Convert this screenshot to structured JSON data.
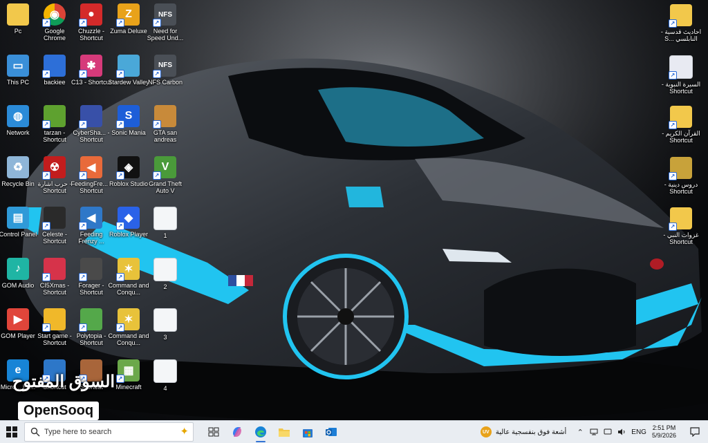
{
  "watermark": {
    "arabic": "السوق المفتوح",
    "english": "OpenSooq"
  },
  "desktop": {
    "col1": [
      {
        "name": "pc-icon",
        "label": "Pc",
        "icon": "user-folder-icon"
      },
      {
        "name": "this-pc-icon",
        "label": "This PC",
        "icon": "monitor-icon"
      },
      {
        "name": "network-icon",
        "label": "Network",
        "icon": "network-globe-icon"
      },
      {
        "name": "recycle-bin-icon",
        "label": "Recycle Bin",
        "icon": "recycle-bin-icon"
      },
      {
        "name": "control-panel-icon",
        "label": "Control Panel",
        "icon": "control-panel-icon"
      },
      {
        "name": "gom-audio-icon",
        "label": "GOM Audio",
        "icon": "gom-audio-icon"
      },
      {
        "name": "gom-player-icon",
        "label": "GOM Player",
        "icon": "gom-player-icon"
      },
      {
        "name": "microsoft-edge-icon",
        "label": "Micro... Ed...",
        "icon": "edge-icon"
      }
    ],
    "col2": [
      {
        "name": "google-chrome-icon",
        "label": "Google Chrome",
        "icon": "chrome-icon"
      },
      {
        "name": "backiee-icon",
        "label": "backiee",
        "icon": "backiee-icon"
      },
      {
        "name": "tarzan-icon",
        "label": "tarzan - Shortcut",
        "icon": "tarzan-icon"
      },
      {
        "name": "war-game-icon",
        "label": "حرب اشارة - Shortcut",
        "icon": "radiation-icon"
      },
      {
        "name": "celeste-icon",
        "label": "Celeste - Shortcut",
        "icon": "strawberry-icon"
      },
      {
        "name": "ci5xmas-icon",
        "label": "CI5Xmas - Shortcut",
        "icon": "xmas-game-icon"
      },
      {
        "name": "start-game-icon",
        "label": "Start game - Shortcut",
        "icon": "start-game-icon"
      },
      {
        "name": "shortcut-bottom-icon",
        "label": "Shortcut",
        "icon": "game-icon"
      }
    ],
    "col3": [
      {
        "name": "chuzzle-icon",
        "label": "Chuzzle - Shortcut",
        "icon": "chuzzle-icon"
      },
      {
        "name": "c13-icon",
        "label": "C13 - Shortcut",
        "icon": "c13-icon"
      },
      {
        "name": "cybershark-icon",
        "label": "CyberSha... - Shortcut",
        "icon": "cybershark-icon"
      },
      {
        "name": "feeding-frenzy-1-icon",
        "label": "FeedingFre... - Shortcut",
        "icon": "fish-icon"
      },
      {
        "name": "feeding-frenzy-2-icon",
        "label": "Feeding Frenzy ...",
        "icon": "fish2-icon"
      },
      {
        "name": "forager-icon",
        "label": "Forager - Shortcut",
        "icon": "forager-icon"
      },
      {
        "name": "polytopia-icon",
        "label": "Polytopia - Shortcut",
        "icon": "polytopia-icon"
      },
      {
        "name": "shortcut-bottom2-icon",
        "label": "Shortcut",
        "icon": "building-icon"
      }
    ],
    "col4": [
      {
        "name": "zuma-deluxe-icon",
        "label": "Zuma Deluxe",
        "icon": "zuma-icon"
      },
      {
        "name": "stardew-valley-icon",
        "label": "Stardew Valley",
        "icon": "stardew-icon"
      },
      {
        "name": "sonic-mania-icon",
        "label": "Sonic Mania",
        "icon": "sonic-icon"
      },
      {
        "name": "roblox-studio-icon",
        "label": "Roblox Studio",
        "icon": "roblox-studio-icon"
      },
      {
        "name": "roblox-player-icon",
        "label": "Roblox Player",
        "icon": "roblox-player-icon"
      },
      {
        "name": "command-conquer-1-icon",
        "label": "Command and Conqu...",
        "icon": "cnc-icon"
      },
      {
        "name": "command-conquer-2-icon",
        "label": "Command and Conqu...",
        "icon": "cnc-icon"
      },
      {
        "name": "minecraft-icon",
        "label": "Minecraft",
        "icon": "minecraft-icon"
      }
    ],
    "col5": [
      {
        "name": "nfs-underground-icon",
        "label": "Need for Speed Und...",
        "icon": "nfs-icon"
      },
      {
        "name": "nfs-carbon-icon",
        "label": "NFS Carbon",
        "icon": "nfs-icon"
      },
      {
        "name": "gta-san-andreas-icon",
        "label": "GTA san andreas",
        "icon": "gta-sa-icon"
      },
      {
        "name": "gta-v-icon",
        "label": "Grand Theft Auto V",
        "icon": "gta-v-icon"
      },
      {
        "name": "file-1-icon",
        "label": "1",
        "icon": "file-icon"
      },
      {
        "name": "file-2-icon",
        "label": "2",
        "icon": "file-icon"
      },
      {
        "name": "file-3-icon",
        "label": "3",
        "icon": "file-icon"
      },
      {
        "name": "file-4-icon",
        "label": "4",
        "icon": "file-icon"
      }
    ],
    "right": [
      {
        "name": "hadith-qudsi-icon",
        "label": "احاديث قدسية - النابلسي ...S",
        "icon": "folder-icon"
      },
      {
        "name": "seerah-icon",
        "label": "السيرة النبوية - Shortcut",
        "icon": "book-icon"
      },
      {
        "name": "quran-icon",
        "label": "القرآن الكريم - Shortcut",
        "icon": "folder-icon"
      },
      {
        "name": "lessons-icon",
        "label": "دروس دينية - Shortcut",
        "icon": "folder-dark-icon"
      },
      {
        "name": "battles-icon",
        "label": "غزوات النبي - Shortcut",
        "icon": "folder-icon"
      }
    ]
  },
  "taskbar": {
    "search_placeholder": "Type here to search",
    "apps": [
      {
        "name": "task-view-icon",
        "icon": "task-view-icon"
      },
      {
        "name": "copilot-icon",
        "icon": "copilot-icon"
      },
      {
        "name": "edge-taskbar-icon",
        "icon": "edge-icon"
      },
      {
        "name": "file-explorer-icon",
        "icon": "folder-icon"
      },
      {
        "name": "microsoft-store-icon",
        "icon": "store-icon"
      },
      {
        "name": "outlook-icon",
        "icon": "outlook-icon"
      }
    ],
    "weather_badge": "UV",
    "weather_text": "أشعة فوق بنفسجية عالية",
    "language": "ENG",
    "time": "2:51 PM",
    "date": "5/9/2026"
  },
  "colors": {
    "accent": "#21c4f0",
    "taskbar": "#e9edf2"
  }
}
